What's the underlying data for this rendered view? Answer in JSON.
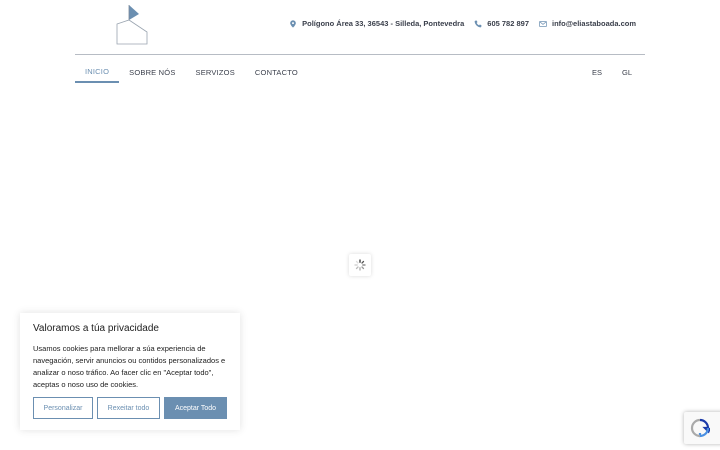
{
  "header": {
    "logo_icon": "house-outline-logo",
    "contact": [
      {
        "icon": "map-pin-icon",
        "text": "Polígono Área 33, 36543 - Silleda, Pontevedra"
      },
      {
        "icon": "phone-icon",
        "text": "605 782 897"
      },
      {
        "icon": "mail-icon",
        "text": "info@eliastaboada.com"
      }
    ]
  },
  "nav": {
    "items": [
      {
        "label": "INICIO",
        "active": true
      },
      {
        "label": "SOBRE NÓS",
        "active": false
      },
      {
        "label": "SERVIZOS",
        "active": false
      },
      {
        "label": "CONTACTO",
        "active": false
      }
    ],
    "languages": [
      "ES",
      "GL"
    ]
  },
  "loader": {
    "icon": "loading-spinner-icon"
  },
  "cookie_banner": {
    "title": "Valoramos a túa privacidade",
    "text": "Usamos cookies para mellorar a súa experiencia de navegación, servir anuncios ou contidos personalizados e analizar o noso tráfico. Ao facer clic en \"Aceptar todo\", aceptas o noso uso de cookies.",
    "buttons": {
      "customize": "Personalizar",
      "reject": "Rexeitar todo",
      "accept": "Aceptar Todo"
    }
  },
  "recaptcha": {
    "icon": "recaptcha-icon"
  },
  "colors": {
    "accent": "#6b8fb1",
    "text": "#3a3f4b"
  }
}
